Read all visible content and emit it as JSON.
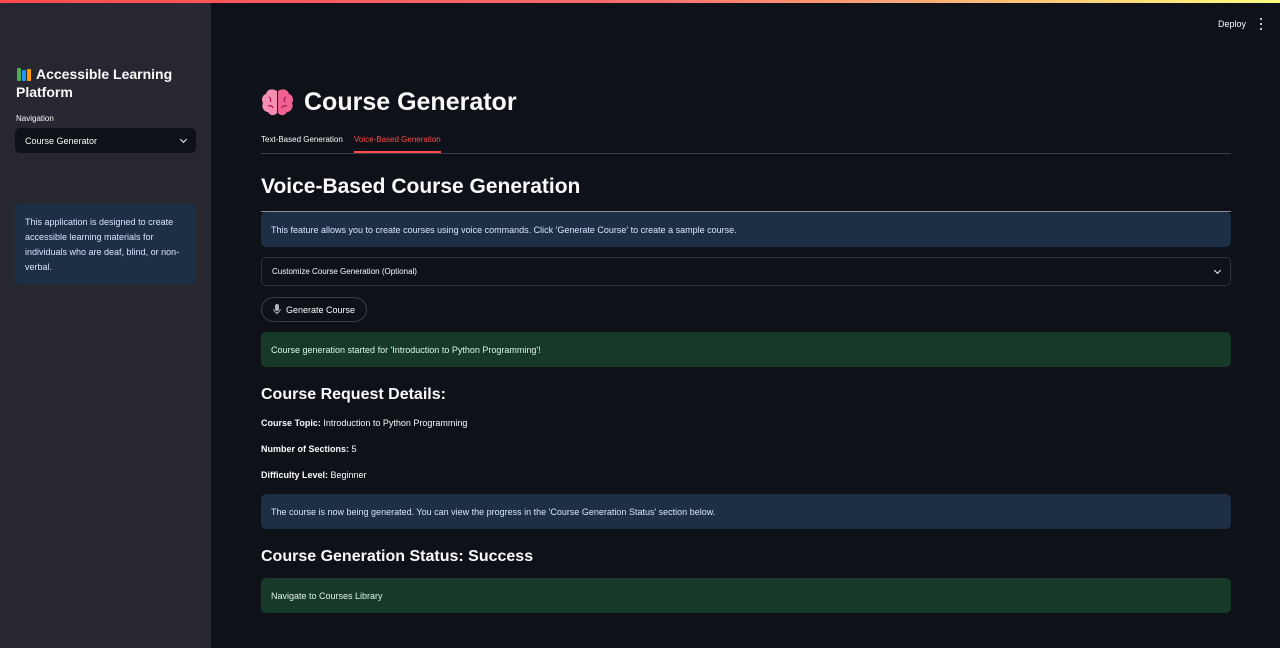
{
  "sidebar": {
    "title": "Accessible Learning Platform",
    "title_icon": "books-icon",
    "nav_label": "Navigation",
    "nav_selected": "Course Generator",
    "info_text": "This application is designed to create accessible learning materials for individuals who are deaf, blind, or non-verbal."
  },
  "header": {
    "deploy_label": "Deploy",
    "menu_icon": "kebab-menu-icon"
  },
  "main": {
    "title": "Course Generator",
    "title_icon": "brain-icon",
    "tabs": [
      {
        "label": "Text-Based Generation",
        "active": false
      },
      {
        "label": "Voice-Based Generation",
        "active": true
      }
    ],
    "section_title": "Voice-Based Course Generation",
    "feature_info": "This feature allows you to create courses using voice commands. Click 'Generate Course' to create a sample course.",
    "expander_label": "Customize Course Generation (Optional)",
    "generate_button": "Generate Course",
    "generate_icon": "microphone-icon",
    "started_message": "Course generation started for 'Introduction to Python Programming'!",
    "request_heading": "Course Request Details:",
    "details": {
      "topic_label": "Course Topic:",
      "topic_value": "Introduction to Python Programming",
      "sections_label": "Number of Sections:",
      "sections_value": "5",
      "difficulty_label": "Difficulty Level:",
      "difficulty_value": "Beginner"
    },
    "progress_info": "The course is now being generated. You can view the progress in the 'Course Generation Status' section below.",
    "status_heading": "Course Generation Status: Success",
    "navigate_message": "Navigate to Courses Library"
  },
  "colors": {
    "background": "#0e1117",
    "sidebar": "#262730",
    "accent": "#ff4b4b",
    "info_bg": "#1c2f45",
    "success_bg": "#173928"
  }
}
